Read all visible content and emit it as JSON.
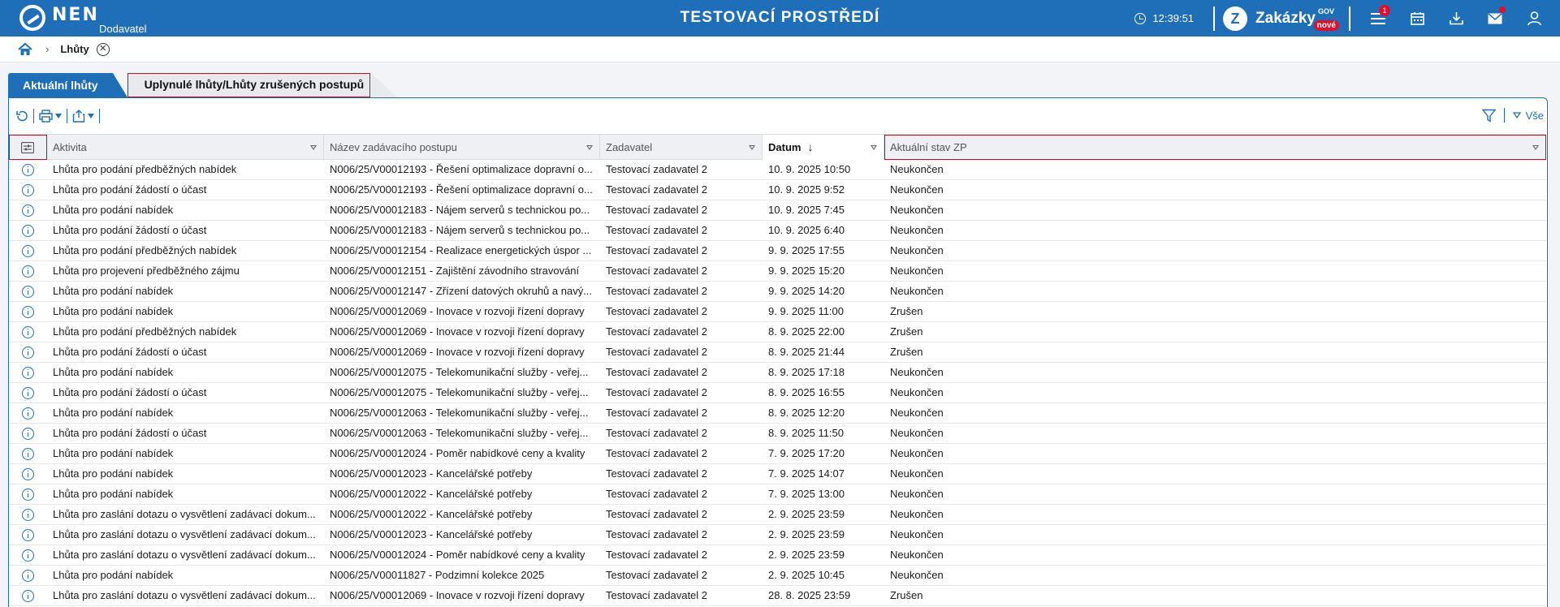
{
  "header": {
    "logo_text": "NEN",
    "logo_sub": "Dodavatel",
    "environment_title": "TESTOVACÍ PROSTŘEDÍ",
    "time": "12:39:51",
    "zakazky_label": "Zakázky",
    "zakazky_sup": "GOV",
    "zakazky_badge": "nové",
    "menu_badge": "1"
  },
  "breadcrumb": {
    "current": "Lhůty"
  },
  "tabs": [
    {
      "label": "Aktuální lhůty",
      "active": true
    },
    {
      "label": "Uplynulé lhůty/Lhůty zrušených postupů",
      "active": false
    }
  ],
  "toolbar": {
    "filter_label": "Vše"
  },
  "table": {
    "columns": [
      "Aktivita",
      "Název zadávacího postupu",
      "Zadavatel",
      "Datum",
      "Aktuální stav ZP"
    ],
    "sorted_column": "Datum",
    "rows": [
      [
        "Lhůta pro podání předběžných nabídek",
        "N006/25/V00012193 - Řešení optimalizace dopravní o...",
        "Testovací zadavatel 2",
        "10. 9. 2025 10:50",
        "Neukončen"
      ],
      [
        "Lhůta pro podání žádostí o účast",
        "N006/25/V00012193 - Řešení optimalizace dopravní o...",
        "Testovací zadavatel 2",
        "10. 9. 2025 9:52",
        "Neukončen"
      ],
      [
        "Lhůta pro podání nabídek",
        "N006/25/V00012183 - Nájem serverů s technickou po...",
        "Testovací zadavatel 2",
        "10. 9. 2025 7:45",
        "Neukončen"
      ],
      [
        "Lhůta pro podání žádostí o účast",
        "N006/25/V00012183 - Nájem serverů s technickou po...",
        "Testovací zadavatel 2",
        "10. 9. 2025 6:40",
        "Neukončen"
      ],
      [
        "Lhůta pro podání předběžných nabídek",
        "N006/25/V00012154 - Realizace energetických úspor ...",
        "Testovací zadavatel 2",
        "9. 9. 2025 17:55",
        "Neukončen"
      ],
      [
        "Lhůta pro projevení předběžného zájmu",
        "N006/25/V00012151 - Zajištění závodního stravování",
        "Testovací zadavatel 2",
        "9. 9. 2025 15:20",
        "Neukončen"
      ],
      [
        "Lhůta pro podání nabídek",
        "N006/25/V00012147 - Zřízení datových okruhů a navý...",
        "Testovací zadavatel 2",
        "9. 9. 2025 14:20",
        "Neukončen"
      ],
      [
        "Lhůta pro podání nabídek",
        "N006/25/V00012069 - Inovace v rozvoji řízení dopravy",
        "Testovací zadavatel 2",
        "9. 9. 2025 11:00",
        "Zrušen"
      ],
      [
        "Lhůta pro podání předběžných nabídek",
        "N006/25/V00012069 - Inovace v rozvoji řízení dopravy",
        "Testovací zadavatel 2",
        "8. 9. 2025 22:00",
        "Zrušen"
      ],
      [
        "Lhůta pro podání žádostí o účast",
        "N006/25/V00012069 - Inovace v rozvoji řízení dopravy",
        "Testovací zadavatel 2",
        "8. 9. 2025 21:44",
        "Zrušen"
      ],
      [
        "Lhůta pro podání nabídek",
        "N006/25/V00012075 - Telekomunikační služby - veřej...",
        "Testovací zadavatel 2",
        "8. 9. 2025 17:18",
        "Neukončen"
      ],
      [
        "Lhůta pro podání žádostí o účast",
        "N006/25/V00012075 - Telekomunikační služby - veřej...",
        "Testovací zadavatel 2",
        "8. 9. 2025 16:55",
        "Neukončen"
      ],
      [
        "Lhůta pro podání nabídek",
        "N006/25/V00012063 - Telekomunikační služby - veřej...",
        "Testovací zadavatel 2",
        "8. 9. 2025 12:20",
        "Neukončen"
      ],
      [
        "Lhůta pro podání žádostí o účast",
        "N006/25/V00012063 - Telekomunikační služby - veřej...",
        "Testovací zadavatel 2",
        "8. 9. 2025 11:50",
        "Neukončen"
      ],
      [
        "Lhůta pro podání nabídek",
        "N006/25/V00012024 - Poměr nabídkové ceny a kvality",
        "Testovací zadavatel 2",
        "7. 9. 2025 17:20",
        "Neukončen"
      ],
      [
        "Lhůta pro podání nabídek",
        "N006/25/V00012023 - Kancelářské potřeby",
        "Testovací zadavatel 2",
        "7. 9. 2025 14:07",
        "Neukončen"
      ],
      [
        "Lhůta pro podání nabídek",
        "N006/25/V00012022 - Kancelářské potřeby",
        "Testovací zadavatel 2",
        "7. 9. 2025 13:00",
        "Neukončen"
      ],
      [
        "Lhůta pro zaslání dotazu o vysvětlení zadávací dokum...",
        "N006/25/V00012022 - Kancelářské potřeby",
        "Testovací zadavatel 2",
        "2. 9. 2025 23:59",
        "Neukončen"
      ],
      [
        "Lhůta pro zaslání dotazu o vysvětlení zadávací dokum...",
        "N006/25/V00012023 - Kancelářské potřeby",
        "Testovací zadavatel 2",
        "2. 9. 2025 23:59",
        "Neukončen"
      ],
      [
        "Lhůta pro zaslání dotazu o vysvětlení zadávací dokum...",
        "N006/25/V00012024 - Poměr nabídkové ceny a kvality",
        "Testovací zadavatel 2",
        "2. 9. 2025 23:59",
        "Neukončen"
      ],
      [
        "Lhůta pro podání nabídek",
        "N006/25/V00011827 - Podzimní kolekce 2025",
        "Testovací zadavatel 2",
        "2. 9. 2025 10:45",
        "Neukončen"
      ],
      [
        "Lhůta pro zaslání dotazu o vysvětlení zadávací dokum...",
        "N006/25/V00012069 - Inovace v rozvoji řízení dopravy",
        "Testovací zadavatel 2",
        "28. 8. 2025 23:59",
        "Zrušen"
      ]
    ]
  },
  "colors": {
    "brand_blue": "#1f6fb8",
    "highlight_red": "#d9001b",
    "badge_red": "#e0102a"
  }
}
